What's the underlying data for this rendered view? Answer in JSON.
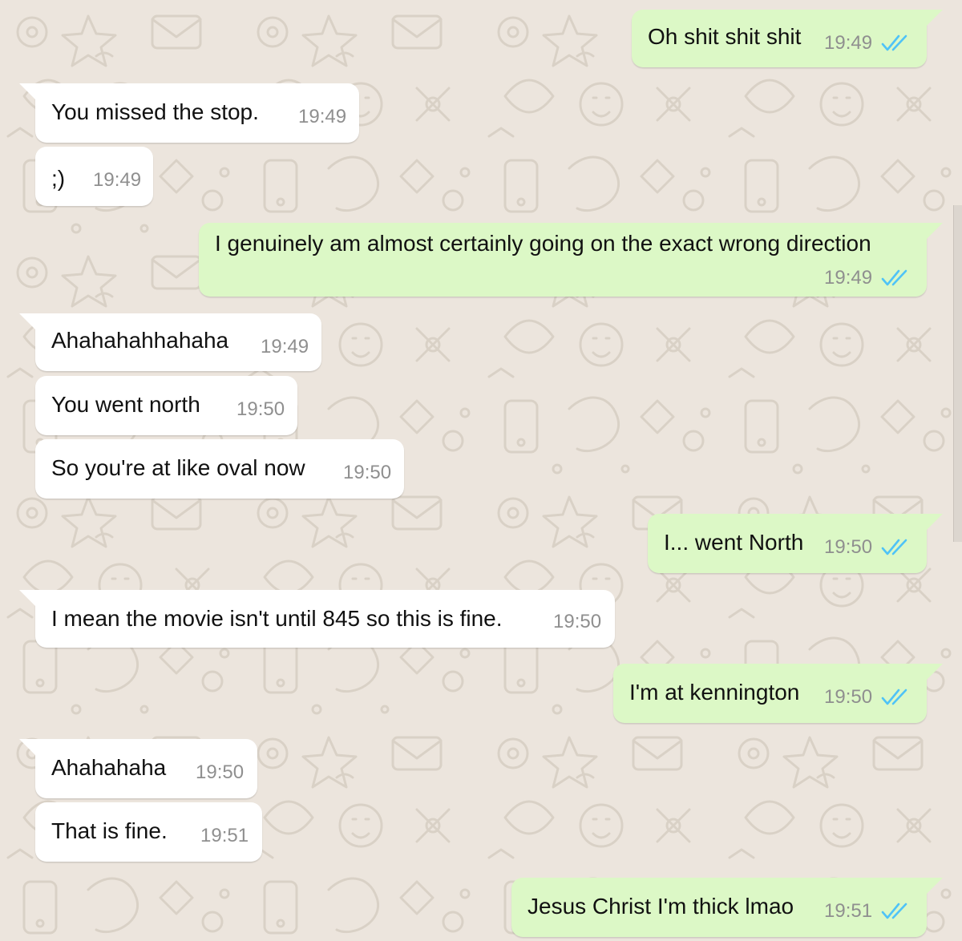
{
  "messages": [
    {
      "dir": "out",
      "text": "Oh shit shit shit",
      "time": "19:49",
      "status": "read-double-tick-icon"
    },
    {
      "dir": "in",
      "text": "You missed the stop.",
      "time": "19:49"
    },
    {
      "dir": "in",
      "text": ";)",
      "time": "19:49"
    },
    {
      "dir": "out",
      "text": "I genuinely am almost certainly going on the exact wrong direction",
      "time": "19:49",
      "status": "read-double-tick-icon"
    },
    {
      "dir": "in",
      "text": "Ahahahahhahaha",
      "time": "19:49"
    },
    {
      "dir": "in",
      "text": "You went north",
      "time": "19:50"
    },
    {
      "dir": "in",
      "text": "So you're at like oval now",
      "time": "19:50"
    },
    {
      "dir": "out",
      "text": "I... went North",
      "time": "19:50",
      "status": "read-double-tick-icon"
    },
    {
      "dir": "in",
      "text": "I mean the movie isn't until 845 so this is fine.",
      "time": "19:50"
    },
    {
      "dir": "out",
      "text": "I'm at kennington",
      "time": "19:50",
      "status": "read-double-tick-icon"
    },
    {
      "dir": "in",
      "text": "Ahahahaha",
      "time": "19:50"
    },
    {
      "dir": "in",
      "text": "That is fine.",
      "time": "19:51"
    },
    {
      "dir": "out",
      "text": "Jesus Christ I'm thick lmao",
      "time": "19:51",
      "status": "read-double-tick-icon"
    }
  ],
  "colors": {
    "background": "#ece5dd",
    "incoming_bubble": "#ffffff",
    "outgoing_bubble": "#dcf8c6",
    "timestamp": "#8f8f8f",
    "read_ticks": "#4fc3f7"
  }
}
